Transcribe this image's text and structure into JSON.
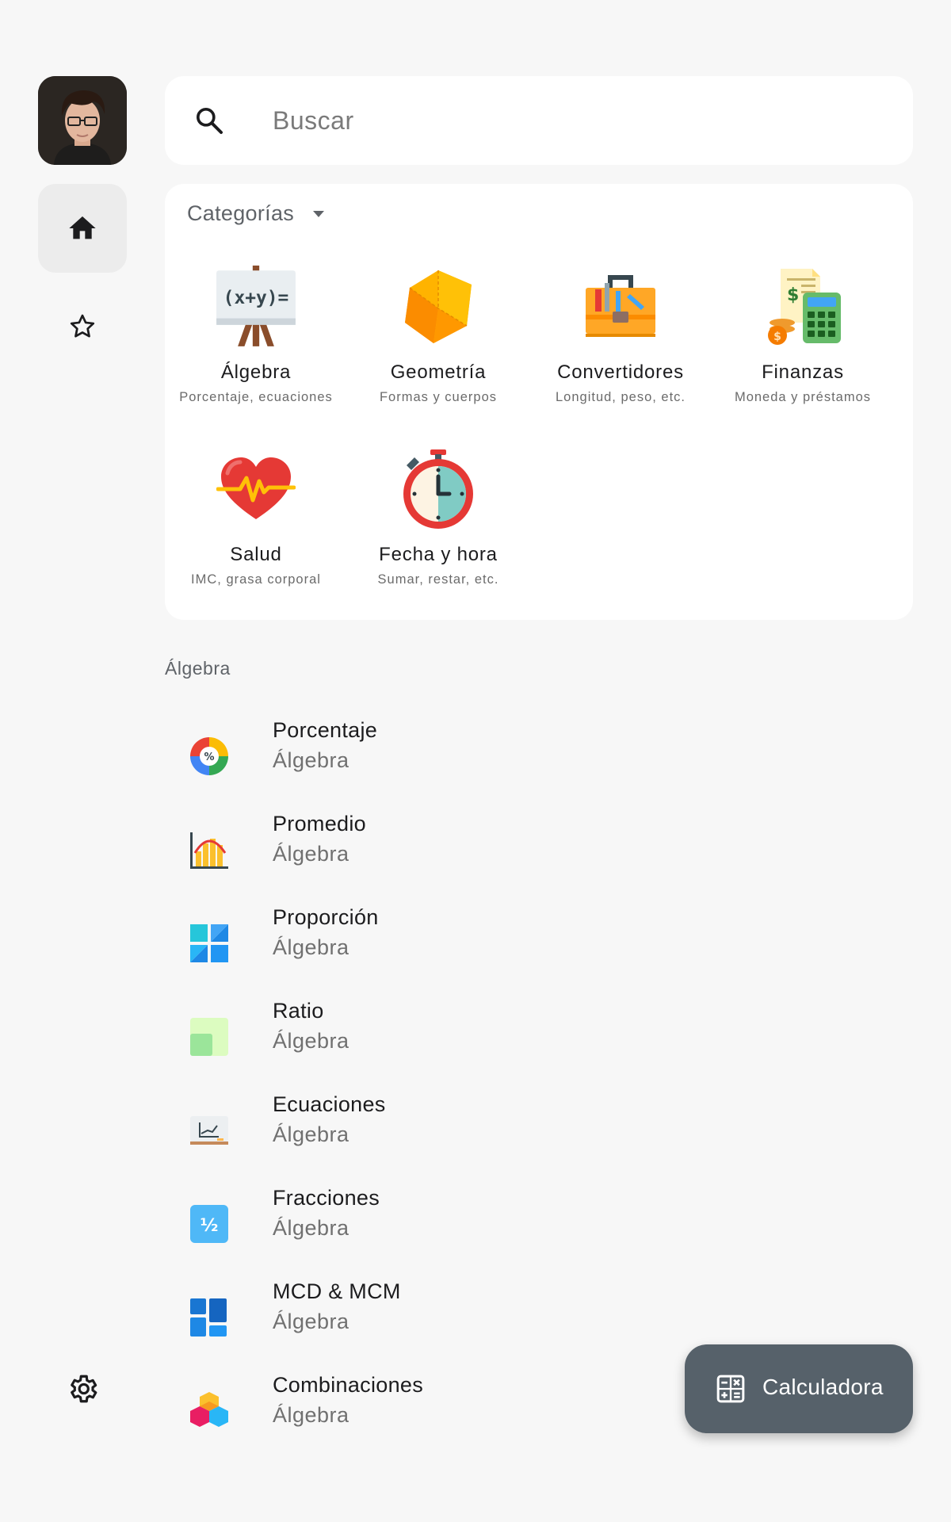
{
  "search": {
    "placeholder": "Buscar"
  },
  "categories": {
    "header": "Categorías",
    "items": [
      {
        "name": "Álgebra",
        "subtitle": "Porcentaje, ecuaciones",
        "icon": "algebra-easel-icon"
      },
      {
        "name": "Geometría",
        "subtitle": "Formas y cuerpos",
        "icon": "geometry-cube-icon"
      },
      {
        "name": "Convertidores",
        "subtitle": "Longitud, peso, etc.",
        "icon": "toolbox-icon"
      },
      {
        "name": "Finanzas",
        "subtitle": "Moneda y préstamos",
        "icon": "finance-calculator-icon"
      },
      {
        "name": "Salud",
        "subtitle": "IMC, grasa corporal",
        "icon": "heartbeat-icon"
      },
      {
        "name": "Fecha y hora",
        "subtitle": "Sumar, restar, etc.",
        "icon": "stopwatch-icon"
      }
    ]
  },
  "section": {
    "label": "Álgebra"
  },
  "list": [
    {
      "title": "Porcentaje",
      "subtitle": "Álgebra",
      "icon": "percent-icon"
    },
    {
      "title": "Promedio",
      "subtitle": "Álgebra",
      "icon": "average-chart-icon"
    },
    {
      "title": "Proporción",
      "subtitle": "Álgebra",
      "icon": "proportion-grid-icon"
    },
    {
      "title": "Ratio",
      "subtitle": "Álgebra",
      "icon": "ratio-squares-icon"
    },
    {
      "title": "Ecuaciones",
      "subtitle": "Álgebra",
      "icon": "equation-board-icon"
    },
    {
      "title": "Fracciones",
      "subtitle": "Álgebra",
      "icon": "fraction-icon"
    },
    {
      "title": "MCD & MCM",
      "subtitle": "Álgebra",
      "icon": "gcd-lcm-blocks-icon"
    },
    {
      "title": "Combinaciones",
      "subtitle": "Álgebra",
      "icon": "combination-cubes-icon"
    }
  ],
  "fab": {
    "label": "Calculadora",
    "icon": "calculator-icon"
  },
  "colors": {
    "background": "#f7f7f7",
    "card": "#ffffff",
    "fab": "#56616a",
    "rail_active": "#ececec"
  }
}
